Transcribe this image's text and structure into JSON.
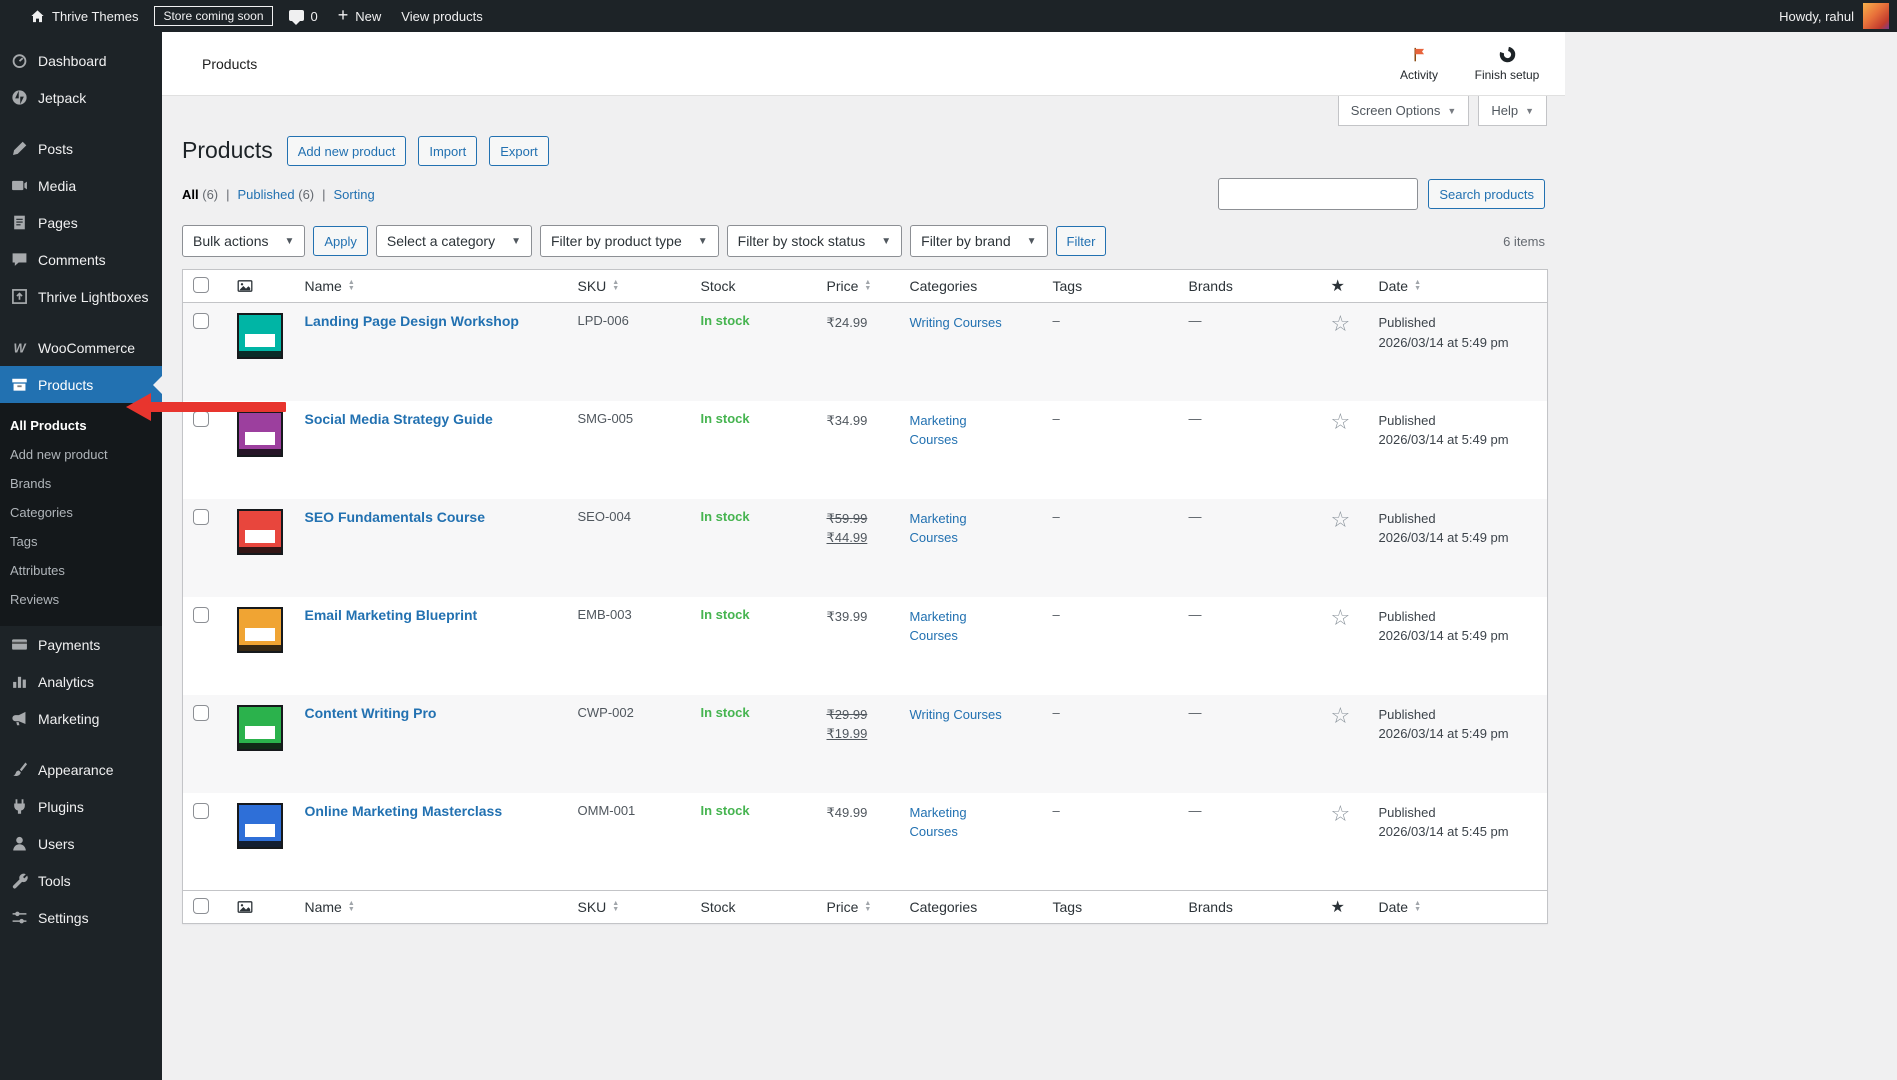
{
  "colors": {
    "accent_blue": "#2271b1",
    "in_stock_green": "#46b450",
    "annotation_red": "#e8352e",
    "sidebar_dark": "#1d2327"
  },
  "admin_bar": {
    "site_name": "Thrive Themes",
    "coming_soon_badge": "Store coming soon",
    "comments_count": "0",
    "new_button": "New",
    "view_products": "View products",
    "howdy": "Howdy, rahul"
  },
  "sidebar": {
    "items": [
      {
        "label": "Dashboard",
        "icon": "dashboard-icon",
        "slug": "dashboard"
      },
      {
        "label": "Jetpack",
        "icon": "jetpack-icon",
        "slug": "jetpack"
      },
      {
        "label": "Posts",
        "icon": "posts-icon",
        "slug": "posts",
        "sep_before": true
      },
      {
        "label": "Media",
        "icon": "media-icon",
        "slug": "media"
      },
      {
        "label": "Pages",
        "icon": "pages-icon",
        "slug": "pages"
      },
      {
        "label": "Comments",
        "icon": "comments-icon",
        "slug": "comments"
      },
      {
        "label": "Thrive Lightboxes",
        "icon": "thrive-lightboxes-icon",
        "slug": "thrive-lightboxes"
      },
      {
        "label": "WooCommerce",
        "icon": "woocommerce-icon",
        "slug": "woocommerce",
        "sep_before": true
      },
      {
        "label": "Products",
        "icon": "products-icon",
        "slug": "products",
        "active": true,
        "submenu": [
          {
            "label": "All Products",
            "current": true
          },
          {
            "label": "Add new product"
          },
          {
            "label": "Brands"
          },
          {
            "label": "Categories"
          },
          {
            "label": "Tags"
          },
          {
            "label": "Attributes"
          },
          {
            "label": "Reviews"
          }
        ]
      },
      {
        "label": "Payments",
        "icon": "payments-icon",
        "slug": "payments"
      },
      {
        "label": "Analytics",
        "icon": "analytics-icon",
        "slug": "analytics"
      },
      {
        "label": "Marketing",
        "icon": "marketing-icon",
        "slug": "marketing"
      },
      {
        "label": "Appearance",
        "icon": "appearance-icon",
        "slug": "appearance",
        "sep_before": true
      },
      {
        "label": "Plugins",
        "icon": "plugins-icon",
        "slug": "plugins"
      },
      {
        "label": "Users",
        "icon": "users-icon",
        "slug": "users"
      },
      {
        "label": "Tools",
        "icon": "tools-icon",
        "slug": "tools"
      },
      {
        "label": "Settings",
        "icon": "settings-icon",
        "slug": "settings"
      }
    ]
  },
  "wc_header": {
    "title": "Products",
    "activity_label": "Activity",
    "finish_setup_label": "Finish setup"
  },
  "screen_tabs": {
    "screen_options": "Screen Options",
    "help": "Help"
  },
  "page": {
    "heading": "Products",
    "buttons": {
      "add_new": "Add new product",
      "import": "Import",
      "export": "Export"
    },
    "views": [
      {
        "label": "All",
        "count": "(6)",
        "current": true
      },
      {
        "label": "Published",
        "count": "(6)",
        "current": false
      },
      {
        "label": "Sorting",
        "count": "",
        "current": false
      }
    ],
    "search": {
      "value": "",
      "button": "Search products"
    },
    "filters": {
      "bulk_actions": "Bulk actions",
      "apply": "Apply",
      "category": "Select a category",
      "product_type": "Filter by product type",
      "stock_status": "Filter by stock status",
      "brand": "Filter by brand",
      "filter_button": "Filter",
      "items_count": "6 items"
    }
  },
  "table": {
    "headers": {
      "name": "Name",
      "sku": "SKU",
      "stock": "Stock",
      "price": "Price",
      "categories": "Categories",
      "tags": "Tags",
      "brands": "Brands",
      "date": "Date"
    },
    "rows": [
      {
        "name": "Landing Page Design Workshop",
        "sku": "LPD-006",
        "stock": "In stock",
        "price": "₹24.99",
        "price_sale": "",
        "categories": "Writing Courses",
        "tags": "–",
        "brands": "—",
        "status": "Published",
        "date": "2026/03/14 at 5:49 pm",
        "thumb_color": "#00b5a5"
      },
      {
        "name": "Social Media Strategy Guide",
        "sku": "SMG-005",
        "stock": "In stock",
        "price": "₹34.99",
        "price_sale": "",
        "categories": "Marketing Courses",
        "tags": "–",
        "brands": "—",
        "status": "Published",
        "date": "2026/03/14 at 5:49 pm",
        "thumb_color": "#9c3f9e"
      },
      {
        "name": "SEO Fundamentals Course",
        "sku": "SEO-004",
        "stock": "In stock",
        "price": "₹59.99",
        "price_sale": "₹44.99",
        "categories": "Marketing Courses",
        "tags": "–",
        "brands": "—",
        "status": "Published",
        "date": "2026/03/14 at 5:49 pm",
        "thumb_color": "#e8463d"
      },
      {
        "name": "Email Marketing Blueprint",
        "sku": "EMB-003",
        "stock": "In stock",
        "price": "₹39.99",
        "price_sale": "",
        "categories": "Marketing Courses",
        "tags": "–",
        "brands": "—",
        "status": "Published",
        "date": "2026/03/14 at 5:49 pm",
        "thumb_color": "#f0a433"
      },
      {
        "name": "Content Writing Pro",
        "sku": "CWP-002",
        "stock": "In stock",
        "price": "₹29.99",
        "price_sale": "₹19.99",
        "categories": "Writing Courses",
        "tags": "–",
        "brands": "—",
        "status": "Published",
        "date": "2026/03/14 at 5:49 pm",
        "thumb_color": "#2bb24c"
      },
      {
        "name": "Online Marketing Masterclass",
        "sku": "OMM-001",
        "stock": "In stock",
        "price": "₹49.99",
        "price_sale": "",
        "categories": "Marketing Courses",
        "tags": "–",
        "brands": "—",
        "status": "Published",
        "date": "2026/03/14 at 5:45 pm",
        "thumb_color": "#2e6fd8"
      }
    ]
  },
  "annotation": {
    "type": "arrow",
    "points_at": "All Products"
  }
}
